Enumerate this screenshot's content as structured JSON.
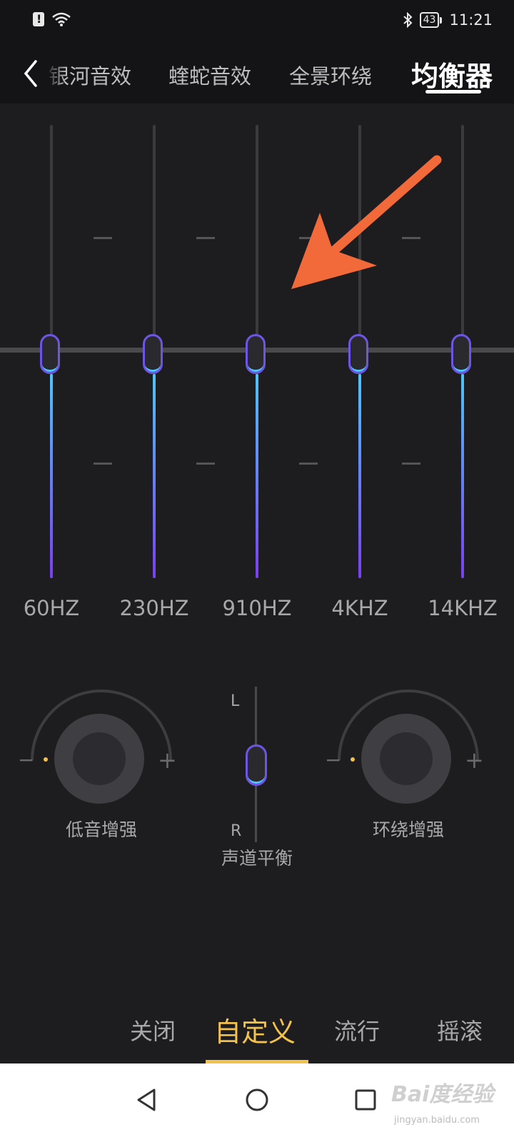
{
  "status_bar": {
    "time": "11:21",
    "battery": "43"
  },
  "header": {
    "tabs": [
      {
        "label": "银河音效"
      },
      {
        "label": "蝰蛇音效"
      },
      {
        "label": "全景环绕"
      },
      {
        "label": "均衡器",
        "active": true
      }
    ]
  },
  "equalizer": {
    "bands": [
      {
        "label": "60HZ",
        "level": 0.5
      },
      {
        "label": "230HZ",
        "level": 0.5
      },
      {
        "label": "910HZ",
        "level": 0.5
      },
      {
        "label": "4KHZ",
        "level": 0.5
      },
      {
        "label": "14KHZ",
        "level": 0.5
      }
    ]
  },
  "controls": {
    "bass_label": "低音增强",
    "balance_label": "声道平衡",
    "balance_left": "L",
    "balance_right": "R",
    "balance_value": 0.5,
    "surround_label": "环绕增强",
    "minus": "−",
    "plus": "+"
  },
  "presets": {
    "items": [
      {
        "label": "关闭"
      },
      {
        "label": "自定义",
        "active": true
      },
      {
        "label": "流行"
      },
      {
        "label": "摇滚"
      }
    ]
  },
  "watermark": {
    "brand": "Bai度经验",
    "url": "jingyan.baidu.com"
  },
  "colors": {
    "accent": "#f2c14e",
    "eq_gradient_top": "#4fc4ff",
    "eq_gradient_bottom": "#7b3ff2",
    "annotation_arrow": "#f26a3a"
  }
}
